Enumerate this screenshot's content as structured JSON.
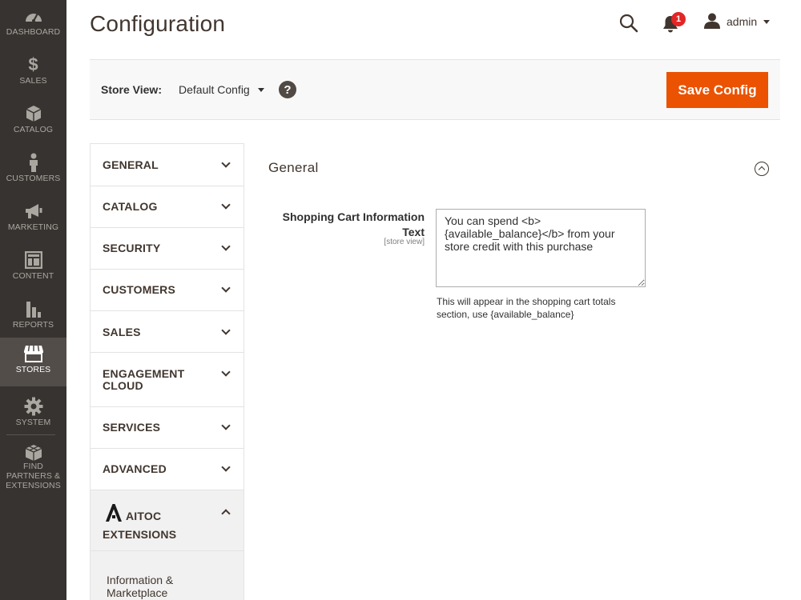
{
  "nav": {
    "items": [
      {
        "key": "dashboard",
        "label": "DASHBOARD",
        "icon": "dashboard-gauge-icon"
      },
      {
        "key": "sales",
        "label": "SALES",
        "icon": "dollar-icon"
      },
      {
        "key": "catalog",
        "label": "CATALOG",
        "icon": "box-icon"
      },
      {
        "key": "customers",
        "label": "CUSTOMERS",
        "icon": "person-icon"
      },
      {
        "key": "marketing",
        "label": "MARKETING",
        "icon": "megaphone-icon"
      },
      {
        "key": "content",
        "label": "CONTENT",
        "icon": "layout-icon"
      },
      {
        "key": "reports",
        "label": "REPORTS",
        "icon": "bar-chart-icon"
      },
      {
        "key": "stores",
        "label": "STORES",
        "icon": "storefront-icon",
        "active": true
      },
      {
        "key": "system",
        "label": "SYSTEM",
        "icon": "gear-icon"
      },
      {
        "key": "partners",
        "label": "FIND PARTNERS & EXTENSIONS",
        "icon": "cubes-icon"
      }
    ]
  },
  "header": {
    "title": "Configuration",
    "notifications_count": "1",
    "user_name": "admin"
  },
  "store_view": {
    "label": "Store View:",
    "selected": "Default Config",
    "help_glyph": "?",
    "save_label": "Save Config"
  },
  "tabs": [
    {
      "label": "GENERAL"
    },
    {
      "label": "CATALOG"
    },
    {
      "label": "SECURITY"
    },
    {
      "label": "CUSTOMERS"
    },
    {
      "label": "SALES"
    },
    {
      "label": "ENGAGEMENT CLOUD"
    },
    {
      "label": "SERVICES"
    },
    {
      "label": "ADVANCED"
    },
    {
      "label": "AITOC EXTENSIONS"
    }
  ],
  "aitoc_subitem": "Information & Marketplace",
  "section": {
    "title": "General",
    "field_label": "Shopping Cart Information Text",
    "field_scope": "[store view]",
    "field_value": "You can spend <b>{available_balance}</b> from your store credit with this purchase",
    "field_note": "This will appear in the shopping cart totals section, use {available_balance}"
  },
  "colors": {
    "sidebar_bg": "#373330",
    "sidebar_active": "#524d49",
    "accent": "#eb5202",
    "badge": "#e22626"
  }
}
